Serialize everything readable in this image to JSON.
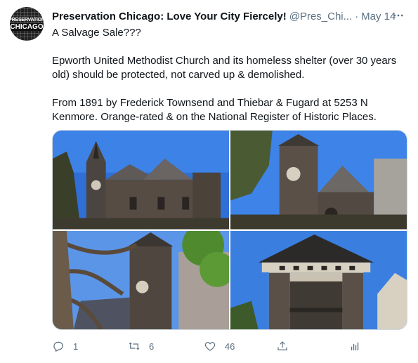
{
  "tweet": {
    "author_name": "Preservation Chicago: Love Your City Fiercely!",
    "handle": "@Pres_Chi...",
    "separator": "·",
    "date": "May 14",
    "avatar": {
      "line1": "PRESERVATION",
      "line2": "CHICAGO"
    },
    "paragraphs": [
      "A Salvage Sale???",
      "Epworth United Methodist Church and its homeless shelter (over 30 years old) should be protected, not carved up & demolished.",
      "From 1891 by Frederick Townsend and Thiebar & Fugard at 5253 N Kenmore.  Orange-rated & on the National Register of Historic Places."
    ],
    "actions": {
      "reply_count": "1",
      "retweet_count": "6",
      "like_count": "46"
    }
  },
  "icons": [
    "more-icon",
    "reply-icon",
    "retweet-icon",
    "like-icon",
    "share-icon",
    "analytics-icon"
  ],
  "colors": {
    "text": "#0f1419",
    "secondary": "#5b7083",
    "sky": "#3b78d8"
  }
}
